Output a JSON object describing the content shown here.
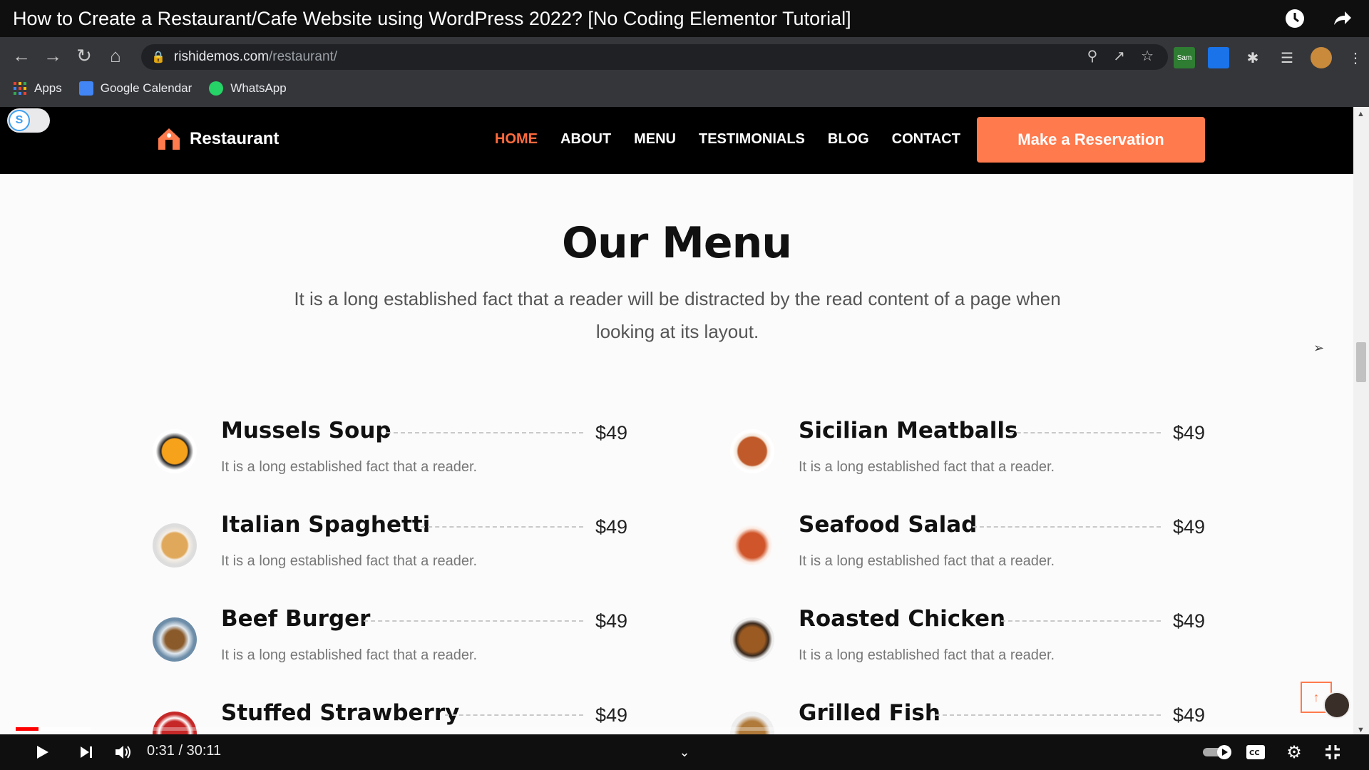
{
  "video": {
    "title": "How to Create a Restaurant/Cafe Website using WordPress 2022? [No Coding Elementor Tutorial]",
    "time_current": "0:31",
    "time_total": "30:11",
    "time_display": "0:31 / 30:11",
    "progress_played": 0.017
  },
  "browser": {
    "url_host": "rishidemos.com",
    "url_path": "/restaurant/",
    "bookmarks": [
      {
        "label": "Apps"
      },
      {
        "label": "Google Calendar"
      },
      {
        "label": "WhatsApp"
      }
    ],
    "extension_badge": "Sam"
  },
  "site": {
    "toggle_letter": "S",
    "logo_text": "Restaurant",
    "nav": [
      "HOME",
      "ABOUT",
      "MENU",
      "TESTIMONIALS",
      "BLOG",
      "CONTACT"
    ],
    "cta": "Make a Reservation",
    "menu_title": "Our Menu",
    "menu_subtitle": "It is a long established fact that a reader will be distracted by the read content of a page when looking at its layout.",
    "items": [
      {
        "name": "Mussels Soup",
        "price": "$49",
        "desc": "It is a long established fact that a reader."
      },
      {
        "name": "Sicilian Meatballs",
        "price": "$49",
        "desc": "It is a long established fact that a reader."
      },
      {
        "name": "Italian Spaghetti",
        "price": "$49",
        "desc": "It is a long established fact that a reader."
      },
      {
        "name": "Seafood Salad",
        "price": "$49",
        "desc": "It is a long established fact that a reader."
      },
      {
        "name": "Beef Burger",
        "price": "$49",
        "desc": "It is a long established fact that a reader."
      },
      {
        "name": "Roasted Chicken",
        "price": "$49",
        "desc": "It is a long established fact that a reader."
      },
      {
        "name": "Stuffed Strawberry",
        "price": "$49",
        "desc": ""
      },
      {
        "name": "Grilled Fish",
        "price": "$49",
        "desc": ""
      }
    ]
  },
  "colors": {
    "accent": "#ff7a4d",
    "header_bg": "#000000",
    "page_bg": "#fcfbfb"
  }
}
